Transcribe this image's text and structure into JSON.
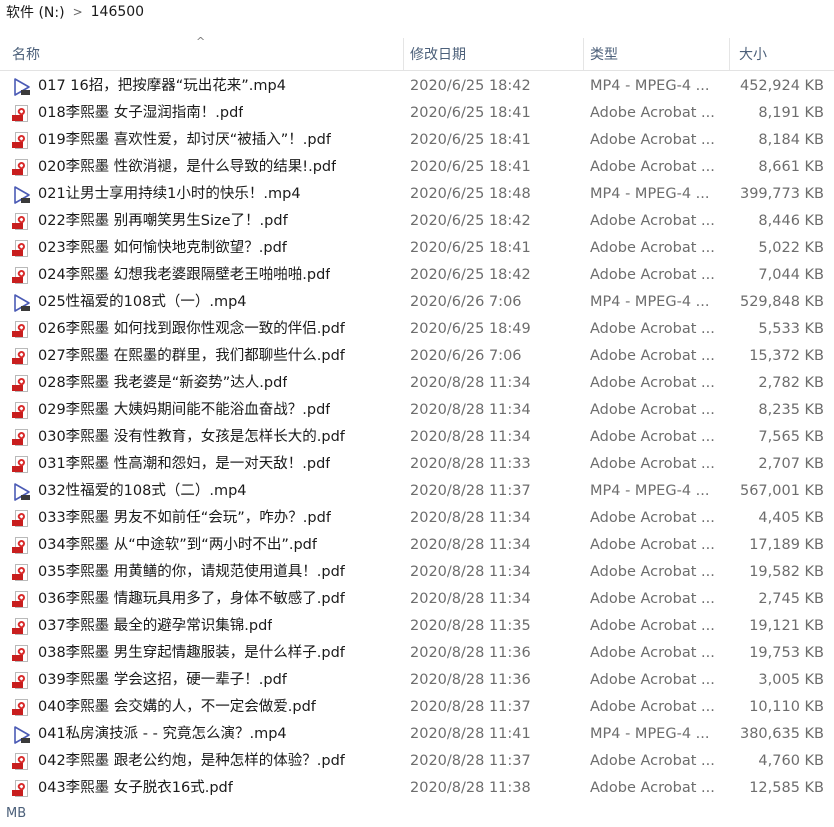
{
  "breadcrumb": {
    "drive": "软件 (N:)",
    "folder": "146500"
  },
  "columns": {
    "name": "名称",
    "date": "修改日期",
    "type": "类型",
    "size": "大小"
  },
  "files": [
    {
      "kind": "mp4",
      "name": "017 16招，把按摩器“玩出花来”.mp4",
      "date": "2020/6/25 18:42",
      "type": "MP4 - MPEG-4 ...",
      "size": "452,924 KB"
    },
    {
      "kind": "pdf",
      "name": "018李熙墨 女子湿润指南！.pdf",
      "date": "2020/6/25 18:41",
      "type": "Adobe Acrobat ...",
      "size": "8,191 KB"
    },
    {
      "kind": "pdf",
      "name": "019李熙墨 喜欢性爱，却讨厌“被插入”！.pdf",
      "date": "2020/6/25 18:41",
      "type": "Adobe Acrobat ...",
      "size": "8,184 KB"
    },
    {
      "kind": "pdf",
      "name": "020李熙墨 性欲消褪，是什么导致的结果!.pdf",
      "date": "2020/6/25 18:41",
      "type": "Adobe Acrobat ...",
      "size": "8,661 KB"
    },
    {
      "kind": "mp4",
      "name": "021让男士享用持续1小时的快乐！.mp4",
      "date": "2020/6/25 18:48",
      "type": "MP4 - MPEG-4 ...",
      "size": "399,773 KB"
    },
    {
      "kind": "pdf",
      "name": "022李熙墨 别再嘲笑男生Size了！.pdf",
      "date": "2020/6/25 18:42",
      "type": "Adobe Acrobat ...",
      "size": "8,446 KB"
    },
    {
      "kind": "pdf",
      "name": "023李熙墨 如何愉快地克制欲望？.pdf",
      "date": "2020/6/25 18:41",
      "type": "Adobe Acrobat ...",
      "size": "5,022 KB"
    },
    {
      "kind": "pdf",
      "name": "024李熙墨 幻想我老婆跟隔壁老王啪啪啪.pdf",
      "date": "2020/6/25 18:42",
      "type": "Adobe Acrobat ...",
      "size": "7,044 KB"
    },
    {
      "kind": "mp4",
      "name": "025性福爱的108式（一）.mp4",
      "date": "2020/6/26 7:06",
      "type": "MP4 - MPEG-4 ...",
      "size": "529,848 KB"
    },
    {
      "kind": "pdf",
      "name": "026李熙墨 如何找到跟你性观念一致的伴侣.pdf",
      "date": "2020/6/25 18:49",
      "type": "Adobe Acrobat ...",
      "size": "5,533 KB"
    },
    {
      "kind": "pdf",
      "name": "027李熙墨 在熙墨的群里，我们都聊些什么.pdf",
      "date": "2020/6/26 7:06",
      "type": "Adobe Acrobat ...",
      "size": "15,372 KB"
    },
    {
      "kind": "pdf",
      "name": "028李熙墨 我老婆是“新姿势”达人.pdf",
      "date": "2020/8/28 11:34",
      "type": "Adobe Acrobat ...",
      "size": "2,782 KB"
    },
    {
      "kind": "pdf",
      "name": "029李熙墨 大姨妈期间能不能浴血奋战？.pdf",
      "date": "2020/8/28 11:34",
      "type": "Adobe Acrobat ...",
      "size": "8,235 KB"
    },
    {
      "kind": "pdf",
      "name": "030李熙墨 没有性教育，女孩是怎样长大的.pdf",
      "date": "2020/8/28 11:34",
      "type": "Adobe Acrobat ...",
      "size": "7,565 KB"
    },
    {
      "kind": "pdf",
      "name": "031李熙墨 性高潮和怨妇，是一对天敌！.pdf",
      "date": "2020/8/28 11:33",
      "type": "Adobe Acrobat ...",
      "size": "2,707 KB"
    },
    {
      "kind": "mp4",
      "name": "032性福爱的108式（二）.mp4",
      "date": "2020/8/28 11:37",
      "type": "MP4 - MPEG-4 ...",
      "size": "567,001 KB"
    },
    {
      "kind": "pdf",
      "name": "033李熙墨 男友不如前任“会玩”，咋办？.pdf",
      "date": "2020/8/28 11:34",
      "type": "Adobe Acrobat ...",
      "size": "4,405 KB"
    },
    {
      "kind": "pdf",
      "name": "034李熙墨 从“中途软”到“两小时不出”.pdf",
      "date": "2020/8/28 11:34",
      "type": "Adobe Acrobat ...",
      "size": "17,189 KB"
    },
    {
      "kind": "pdf",
      "name": "035李熙墨 用黄鳝的你，请规范使用道具！.pdf",
      "date": "2020/8/28 11:34",
      "type": "Adobe Acrobat ...",
      "size": "19,582 KB"
    },
    {
      "kind": "pdf",
      "name": "036李熙墨 情趣玩具用多了，身体不敏感了.pdf",
      "date": "2020/8/28 11:34",
      "type": "Adobe Acrobat ...",
      "size": "2,745 KB"
    },
    {
      "kind": "pdf",
      "name": "037李熙墨 最全的避孕常识集锦.pdf",
      "date": "2020/8/28 11:35",
      "type": "Adobe Acrobat ...",
      "size": "19,121 KB"
    },
    {
      "kind": "pdf",
      "name": "038李熙墨 男生穿起情趣服装，是什么样子.pdf",
      "date": "2020/8/28 11:36",
      "type": "Adobe Acrobat ...",
      "size": "19,753 KB"
    },
    {
      "kind": "pdf",
      "name": "039李熙墨 学会这招，硬一辈子！.pdf",
      "date": "2020/8/28 11:36",
      "type": "Adobe Acrobat ...",
      "size": "3,005 KB"
    },
    {
      "kind": "pdf",
      "name": "040李熙墨 会交媾的人，不一定会做爱.pdf",
      "date": "2020/8/28 11:37",
      "type": "Adobe Acrobat ...",
      "size": "10,110 KB"
    },
    {
      "kind": "mp4",
      "name": "041私房演技派 - - 究竟怎么演？.mp4",
      "date": "2020/8/28 11:41",
      "type": "MP4 - MPEG-4 ...",
      "size": "380,635 KB"
    },
    {
      "kind": "pdf",
      "name": "042李熙墨 跟老公约炮，是种怎样的体验？.pdf",
      "date": "2020/8/28 11:37",
      "type": "Adobe Acrobat ...",
      "size": "4,760 KB"
    },
    {
      "kind": "pdf",
      "name": "043李熙墨 女子脱衣16式.pdf",
      "date": "2020/8/28 11:38",
      "type": "Adobe Acrobat ...",
      "size": "12,585 KB"
    }
  ],
  "footer": {
    "text": "MB"
  }
}
